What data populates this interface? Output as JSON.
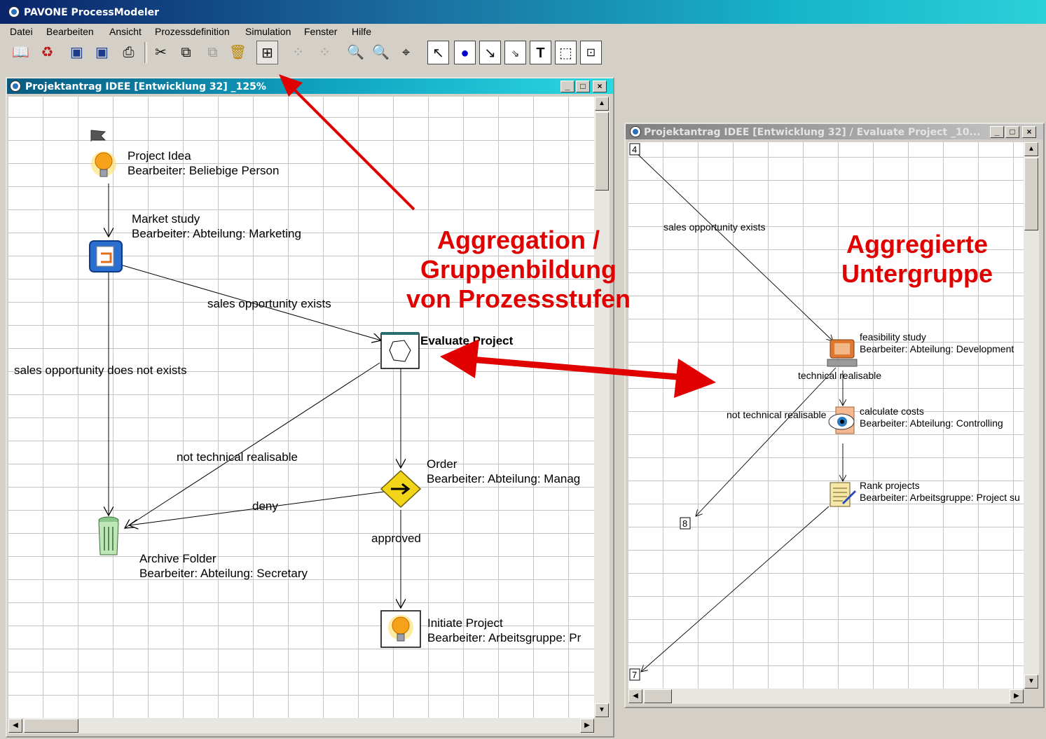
{
  "app": {
    "title": "PAVONE ProcessModeler"
  },
  "menu": [
    {
      "label": "Datei"
    },
    {
      "label": "Bearbeiten"
    },
    {
      "label": "Ansicht"
    },
    {
      "label": "Prozessdefinition"
    },
    {
      "label": "Simulation"
    },
    {
      "label": "Fenster"
    },
    {
      "label": "Hilfe"
    }
  ],
  "toolbar": [
    {
      "icon": "book-icon"
    },
    {
      "icon": "refresh-icon"
    },
    {
      "icon": "export-icon"
    },
    {
      "icon": "import-icon"
    },
    {
      "icon": "print-icon"
    },
    {
      "icon": "cut-icon"
    },
    {
      "icon": "copy-icon"
    },
    {
      "icon": "paste-icon"
    },
    {
      "icon": "delete-icon"
    },
    {
      "icon": "aggregate-icon"
    },
    {
      "icon": "expand-icon"
    },
    {
      "icon": "collapse-icon"
    },
    {
      "icon": "zoom-out-icon"
    },
    {
      "icon": "zoom-in-icon"
    },
    {
      "icon": "zoom-fit-icon"
    },
    {
      "icon": "pointer-icon"
    },
    {
      "icon": "circle-node-icon"
    },
    {
      "icon": "connector-icon"
    },
    {
      "icon": "multi-connector-icon"
    },
    {
      "icon": "text-tool-icon"
    },
    {
      "icon": "select-area-icon"
    },
    {
      "icon": "subprocess-icon"
    }
  ],
  "main_window": {
    "title": "Projektantrag IDEE [Entwicklung 32] _125%",
    "buttons": {
      "minimize": "_",
      "maximize": "□",
      "close": "×"
    },
    "nodes": {
      "project_idea": {
        "name": "Project Idea",
        "worker": "Bearbeiter: Beliebige Person"
      },
      "market_study": {
        "name": "Market study",
        "worker": "Bearbeiter: Abteilung: Marketing"
      },
      "evaluate_project": {
        "name": "Evaluate Project"
      },
      "order": {
        "name": "Order",
        "worker": "Bearbeiter: Abteilung: Manag"
      },
      "archive_folder": {
        "name": "Archive Folder",
        "worker": "Bearbeiter: Abteilung: Secretary"
      },
      "initiate_project": {
        "name": "Initiate Project",
        "worker": "Bearbeiter: Arbeitsgruppe: Pr"
      }
    },
    "edges": {
      "sales_exists": "sales opportunity exists",
      "sales_not_exists": "sales opportunity does not exists",
      "not_technical": "not technical realisable",
      "deny": "deny",
      "approved": "approved"
    }
  },
  "sub_window": {
    "title": "Projektantrag IDEE [Entwicklung 32] / Evaluate Project _10...",
    "buttons": {
      "minimize": "_",
      "maximize": "□",
      "close": "×"
    },
    "connectors": {
      "in": "4",
      "out_archive": "8",
      "out_next": "7"
    },
    "nodes": {
      "feasibility": {
        "name": "feasibility study",
        "worker": "Bearbeiter: Abteilung: Development"
      },
      "calculate": {
        "name": "calculate costs",
        "worker": "Bearbeiter: Abteilung: Controlling"
      },
      "rank": {
        "name": "Rank projects",
        "worker": "Bearbeiter: Arbeitsgruppe: Project su"
      }
    },
    "edges": {
      "sales_exists": "sales opportunity exists",
      "technical": "technical realisable",
      "not_technical": "not technical realisable"
    }
  },
  "annotations": {
    "aggregation": [
      "Aggregation /",
      "Gruppenbildung",
      "von Prozessstufen"
    ],
    "subgroup": [
      "Aggregierte",
      "Untergruppe"
    ],
    "color": "#e00000"
  }
}
